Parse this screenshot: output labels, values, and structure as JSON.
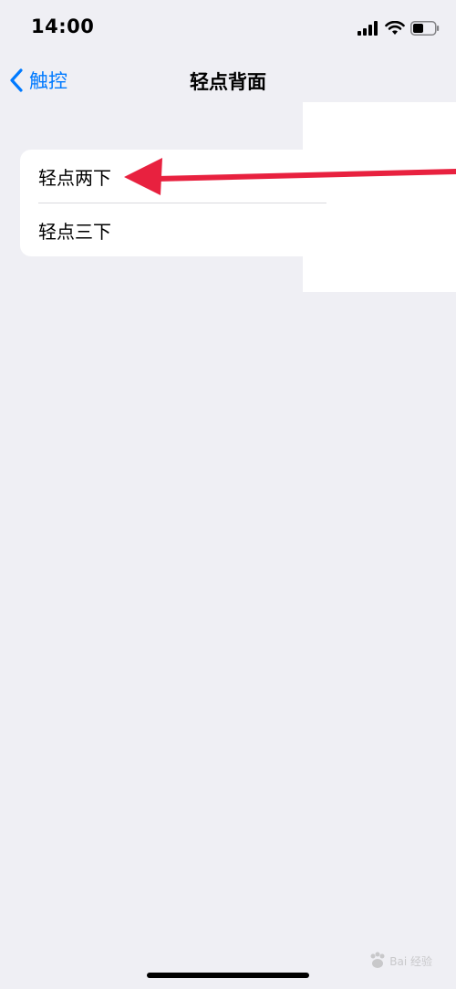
{
  "status_bar": {
    "time": "14:00",
    "icons": [
      "signal-icon",
      "wifi-icon",
      "battery-icon"
    ]
  },
  "nav": {
    "back_label": "触控",
    "title": "轻点背面"
  },
  "list": {
    "items": [
      {
        "label": "轻点两下"
      },
      {
        "label": "轻点三下"
      }
    ]
  },
  "annotation": {
    "arrow_color": "#e8213f"
  },
  "watermark": {
    "text": "Bai 经验"
  },
  "colors": {
    "background": "#efeff4",
    "accent": "#007aff"
  }
}
